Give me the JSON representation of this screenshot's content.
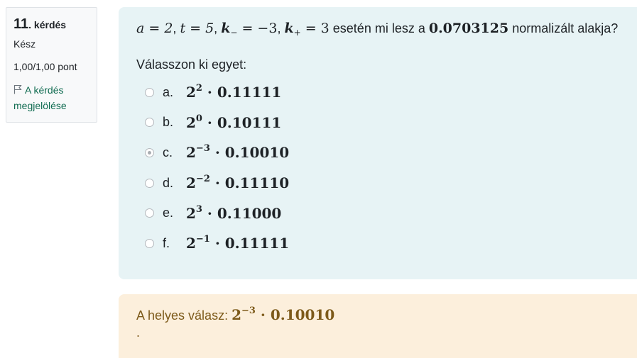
{
  "info": {
    "number": "11",
    "label": ". kérdés",
    "state": "Kész",
    "grade": "1,00/1,00 pont",
    "flag_label": "A kérdés megjelölése",
    "flag_icon": "flag-icon"
  },
  "question": {
    "params": {
      "a": "a = 2",
      "t": "t = 5",
      "k_minus_var": "k",
      "k_minus_sub": "−",
      "k_minus_val": " = −3",
      "k_plus_var": "k",
      "k_plus_sub": "+",
      "k_plus_val": " = 3",
      "sep": ", "
    },
    "text_middle": " esetén mi lesz a ",
    "number": "0.0703125",
    "text_end": " normalizált alakja?",
    "prompt": "Válasszon ki egyet:"
  },
  "options": [
    {
      "letter": "a.",
      "base": "2",
      "exp": "2",
      "mantissa": " · 0.11111",
      "checked": false
    },
    {
      "letter": "b.",
      "base": "2",
      "exp": "0",
      "mantissa": " · 0.10111",
      "checked": false
    },
    {
      "letter": "c.",
      "base": "2",
      "exp": "−3",
      "mantissa": " · 0.10010",
      "checked": true
    },
    {
      "letter": "d.",
      "base": "2",
      "exp": "−2",
      "mantissa": " · 0.11110",
      "checked": false
    },
    {
      "letter": "e.",
      "base": "2",
      "exp": "3",
      "mantissa": " · 0.11000",
      "checked": false
    },
    {
      "letter": "f.",
      "base": "2",
      "exp": "−1",
      "mantissa": " · 0.11111",
      "checked": false
    }
  ],
  "feedback": {
    "label": "A helyes válasz: ",
    "base": "2",
    "exp": "−3",
    "mantissa": " · 0.10010",
    "trailing": "."
  },
  "colors": {
    "info_bg": "#f8f9fa",
    "formulation_bg": "#e7f3f5",
    "feedback_bg": "#fcefdc",
    "feedback_text": "#7d5a1a",
    "link": "#0f6b50"
  }
}
